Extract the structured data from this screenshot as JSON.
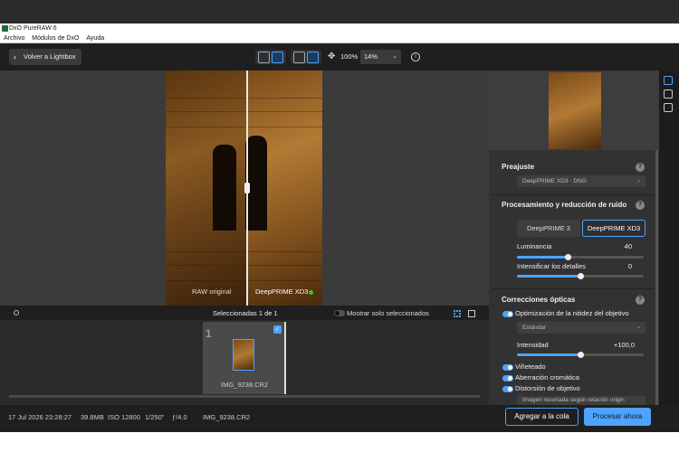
{
  "window": {
    "title": "DxO PureRAW 6"
  },
  "menu": [
    "Archivo",
    "Módulos de DxO",
    "Ayuda"
  ],
  "toolbar": {
    "back_label": "Volver a Lightbox",
    "zoom_percent": "100%",
    "zoom_select": "14%"
  },
  "viewer": {
    "label_left": "RAW original",
    "label_right": "DeepPRIME XD3"
  },
  "filmstrip": {
    "selected_count": "Seleccionadas 1 de 1",
    "only_selected": "Mostrar solo seleccionados",
    "thumb_number": "1",
    "thumb_name": "IMG_9238.CR2"
  },
  "panel": {
    "preset": {
      "title": "Preajuste",
      "value": "DeepPRIME XD3 - DNG"
    },
    "noise": {
      "title": "Procesamiento y reducción de ruido",
      "option_a": "DeepPRIME 3",
      "option_b": "DeepPRIME XD3",
      "luminance_label": "Luminancia",
      "luminance_value": "40",
      "luminance_fraction": 0.4,
      "detail_label": "Intensificar los detalles",
      "detail_value": "0",
      "detail_fraction": 0.5
    },
    "optics": {
      "title": "Correcciones ópticas",
      "sharpness_label": "Optimización de la nitidez del objetivo",
      "sharpness_mode": "Estándar",
      "intensity_label": "Intensidad",
      "intensity_value": "+100,0",
      "intensity_fraction": 0.5,
      "vignetting_label": "Viñeteado",
      "chromatic_label": "Aberración cromática",
      "distortion_label": "Distorsión de objetivo",
      "distortion_mode": "Imagen recortada según relación origin"
    }
  },
  "status": {
    "date": "17 Jul 2026 23:28:27",
    "size": "39.8MB",
    "iso": "ISO 12800",
    "shutter": "1/250\"",
    "aperture": "ƒ/4.0",
    "filename": "IMG_9238.CR2",
    "add_queue": "Agregar a la cola",
    "process_now": "Procesar ahora"
  },
  "colors": {
    "accent": "#4da3ff",
    "background": "#2b2b2b",
    "toolbar": "#1f1f1f"
  }
}
